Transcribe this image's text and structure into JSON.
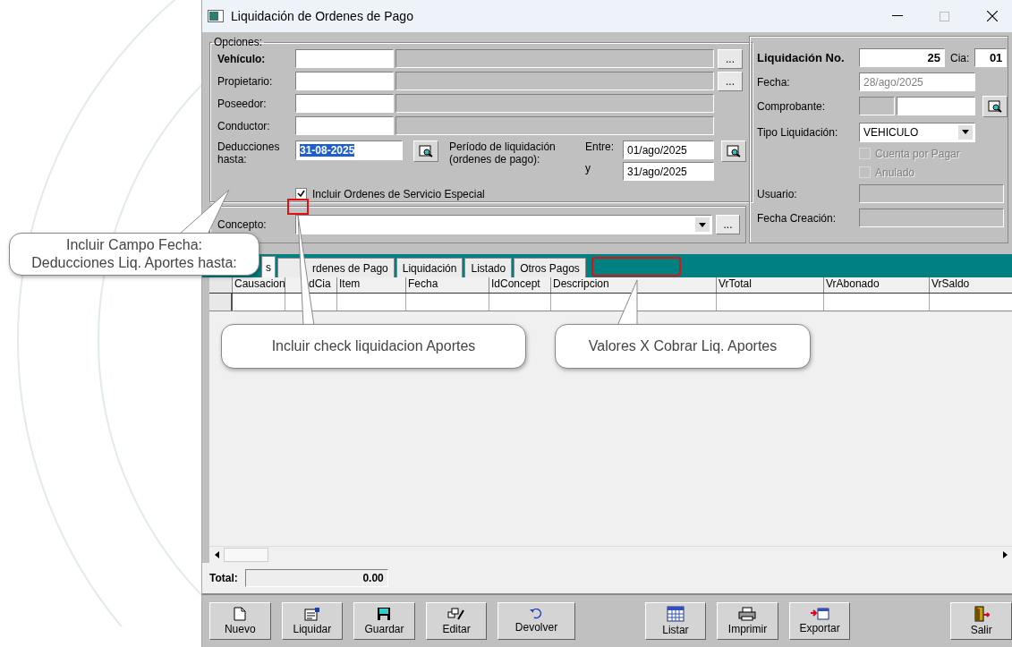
{
  "window": {
    "title": "Liquidación de Ordenes de Pago"
  },
  "options": {
    "legend": "Opciones:",
    "rows": [
      {
        "label": "Vehículo:",
        "bold": true,
        "lookup": "..."
      },
      {
        "label": "Propietario:",
        "bold": false,
        "lookup": "..."
      },
      {
        "label": "Poseedor:",
        "bold": false
      },
      {
        "label": "Conductor:",
        "bold": false
      }
    ],
    "deductions": {
      "label": "Deducciones hasta:",
      "value": "31-08-2025",
      "text_selected": true
    },
    "period_label": "Período de liquidación (ordenes de pago):",
    "from_label": "Entre:",
    "from": "01/ago/2025",
    "to_label": "y",
    "to": "31/ago/2025",
    "special_orders": {
      "label": "Incluir Ordenes de Servicio Especial",
      "checked": true
    }
  },
  "concept": {
    "label": "Concepto:",
    "lookup": "..."
  },
  "summary": {
    "number_label": "Liquidación No.",
    "number": "25",
    "cia_label": "Cia:",
    "cia": "01",
    "date_label": "Fecha:",
    "date": "28/ago/2025",
    "voucher_label": "Comprobante:",
    "type_label": "Tipo Liquidación:",
    "type": "VEHICULO",
    "flags": [
      {
        "label": "Cuenta por Pagar",
        "checked": false,
        "disabled": true
      },
      {
        "label": "Anulado",
        "checked": false,
        "disabled": true
      }
    ],
    "user_label": "Usuario:",
    "created_label": "Fecha Creación:"
  },
  "tabs": [
    {
      "label": "s",
      "selected": true
    },
    {
      "label": "rdenes de Pago",
      "selected": false
    },
    {
      "label": "Liquidación",
      "selected": false
    },
    {
      "label": "Listado",
      "selected": false
    },
    {
      "label": "Otros Pagos",
      "selected": false
    }
  ],
  "table": {
    "columns": [
      "Causacion",
      "dCia",
      "Item",
      "Fecha",
      "IdConcept",
      "Descripcion",
      "VrTotal",
      "VrAbonado",
      "VrSaldo"
    ]
  },
  "total": {
    "label": "Total:",
    "value": "0.00"
  },
  "buttons": [
    {
      "label": "Nuevo",
      "spaced": false
    },
    {
      "label": "Liquidar",
      "spaced": false
    },
    {
      "label": "Guardar",
      "spaced": false
    },
    {
      "label": "Editar",
      "spaced": false
    },
    {
      "label": "Devolver",
      "spaced": false
    },
    {
      "label": "Listar",
      "spaced": true
    },
    {
      "label": "Imprimir",
      "spaced": false
    },
    {
      "label": "Exportar",
      "spaced": false
    },
    {
      "label": "Salir",
      "spaced": true
    }
  ],
  "annotations": [
    {
      "text": "Incluir Campo Fecha:\nDeducciones Liq. Aportes hasta:"
    },
    {
      "text": "Incluir check liquidacion Aportes"
    },
    {
      "text": "Valores X Cobrar Liq. Aportes"
    }
  ]
}
